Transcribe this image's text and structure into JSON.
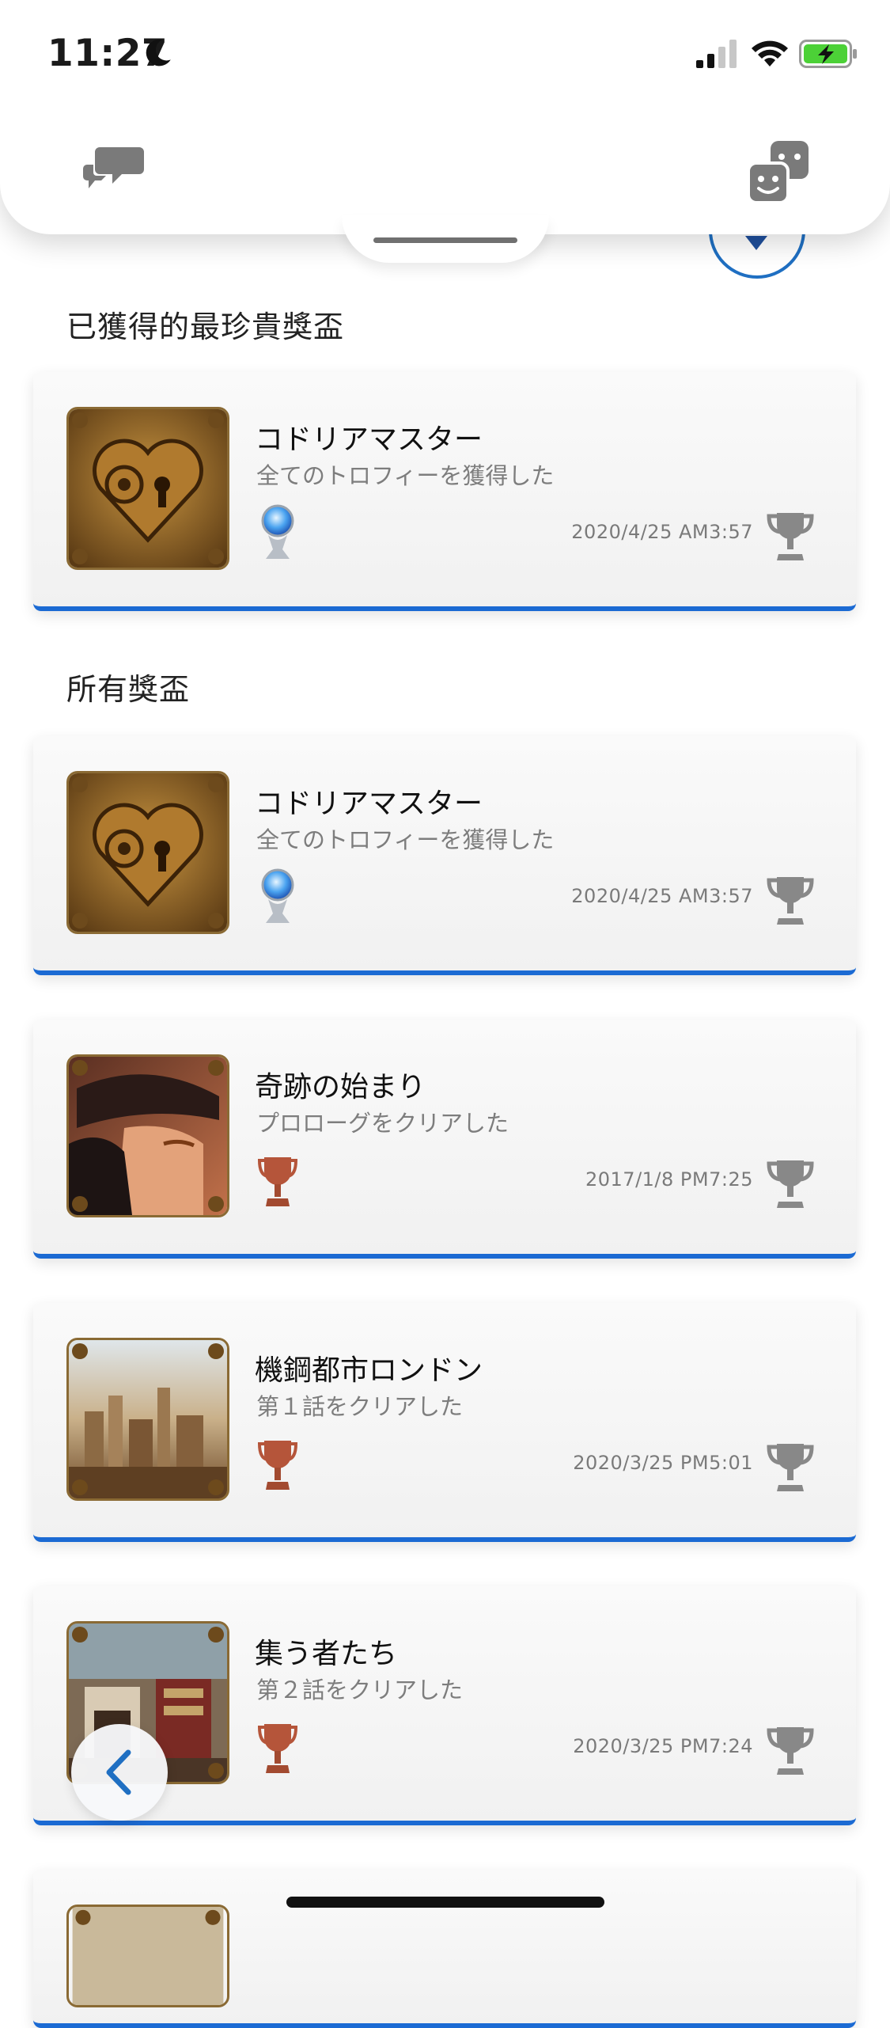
{
  "status_bar": {
    "time": "11:27",
    "battery_color": "#4cd137"
  },
  "accent_color": "#1b6ad3",
  "sections": {
    "rarest_title": "已獲得的最珍貴獎盃",
    "all_title": "所有獎盃"
  },
  "rarest_trophy": {
    "name": "コドリアマスター",
    "description": "全てのトロフィーを獲得した",
    "date": "2020/4/25  AM3:57",
    "grade": "platinum",
    "thumb": "heart-gear-art"
  },
  "trophies": [
    {
      "name": "コドリアマスター",
      "description": "全てのトロフィーを獲得した",
      "date": "2020/4/25  AM3:57",
      "grade": "platinum",
      "thumb": "heart-gear-art"
    },
    {
      "name": "奇跡の始まり",
      "description": "プロローグをクリアした",
      "date": "2017/1/8  PM7:25",
      "grade": "bronze",
      "thumb": "character-portrait-art"
    },
    {
      "name": "機鋼都市ロンドン",
      "description": "第１話をクリアした",
      "date": "2020/3/25  PM5:01",
      "grade": "bronze",
      "thumb": "city-skyline-art"
    },
    {
      "name": "集う者たち",
      "description": "第２話をクリアした",
      "date": "2020/3/25  PM7:24",
      "grade": "bronze",
      "thumb": "interior-room-art"
    }
  ],
  "icons": {
    "chat": "chat-bubbles-icon",
    "friends": "friends-icon",
    "back": "chevron-left-icon",
    "earned": "trophy-icon"
  }
}
